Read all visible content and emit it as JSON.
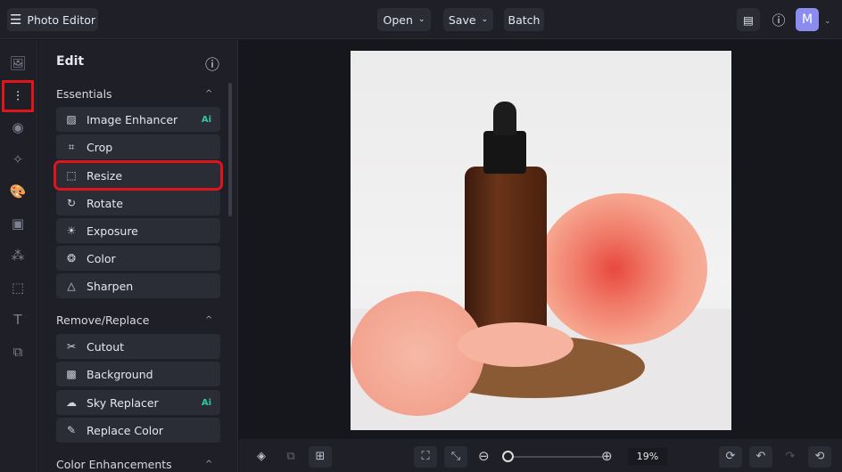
{
  "header": {
    "app_title": "Photo Editor",
    "open": "Open",
    "save": "Save",
    "batch": "Batch",
    "avatar": "M"
  },
  "panel": {
    "title": "Edit",
    "sections": [
      {
        "label": "Essentials",
        "items": [
          {
            "label": "Image Enhancer",
            "badge": "Ai"
          },
          {
            "label": "Crop"
          },
          {
            "label": "Resize"
          },
          {
            "label": "Rotate"
          },
          {
            "label": "Exposure"
          },
          {
            "label": "Color"
          },
          {
            "label": "Sharpen"
          }
        ]
      },
      {
        "label": "Remove/Replace",
        "items": [
          {
            "label": "Cutout"
          },
          {
            "label": "Background"
          },
          {
            "label": "Sky Replacer",
            "badge": "Ai"
          },
          {
            "label": "Replace Color"
          }
        ]
      },
      {
        "label": "Color Enhancements",
        "items": []
      }
    ]
  },
  "footer": {
    "zoom": "19%",
    "zoom_fraction": 0.0
  }
}
